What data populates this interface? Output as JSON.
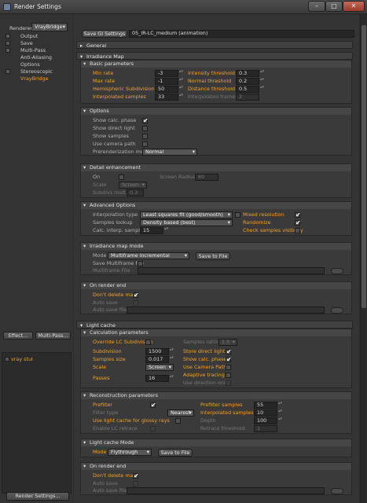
{
  "window": {
    "title": "Render Settings",
    "min": "–",
    "max": "□",
    "close": "✕"
  },
  "left": {
    "renderer_label": "Renderer",
    "renderer_value": "VrayBridge",
    "tree": [
      {
        "label": "Output"
      },
      {
        "label": "Save"
      },
      {
        "label": "Multi-Pass"
      },
      {
        "label": "Anti-Aliasing"
      },
      {
        "label": "Options"
      },
      {
        "label": "Stereoscopic"
      },
      {
        "label": "VrayBridge"
      }
    ],
    "effect_button": "Effect...",
    "multipass_button": "Multi-Pass...",
    "preset": "vray stul",
    "render_settings_button": "Render Settings..."
  },
  "top": {
    "save_gi_button": "Save GI Settings",
    "gi_path": "05_IR-LC_medium (animation)"
  },
  "sections": {
    "general": "General",
    "irradiance": "Irradiance Map",
    "lightcache": "Light cache"
  },
  "basic": {
    "title": "Basic parameters",
    "min_rate": "Min rate",
    "min_rate_val": "-3",
    "max_rate": "Max rate",
    "max_rate_val": "-1",
    "hemi": "Hemispheric Subdivision",
    "hemi_val": "50",
    "interp": "Interpolated samples",
    "interp_val": "33",
    "intensity": "Intensity threshold",
    "intensity_val": "0.3",
    "normal": "Normal threshold",
    "normal_val": "0.2",
    "distance": "Distance threshold",
    "distance_val": "0.5",
    "interp_frames": "Interpolated frames",
    "interp_frames_val": "2"
  },
  "options": {
    "title": "Options",
    "show_calc": "Show calc. phase",
    "show_direct": "Show direct light",
    "show_samples": "Show samples",
    "use_camera": "Use camera path",
    "prerender": "Prerenderization mode",
    "prerender_val": "Normal"
  },
  "detail": {
    "title": "Detail enhancement",
    "on": "On",
    "screen_radius": "Screen Radius",
    "screen_radius_val": "60",
    "scale": "Scale",
    "scale_val": "Screen",
    "subdivs": "Subdivs mult.",
    "subdivs_val": "0.3"
  },
  "advanced": {
    "title": "Advanced Options",
    "interp_type": "Interpolation type",
    "interp_type_val": "Least squares fit (good/smooth)",
    "samples_lookup": "Samples lookup",
    "samples_lookup_val": "Density based (best)",
    "calc_interp": "Calc. interp. samples",
    "calc_interp_val": "15",
    "mixed": "Mixed resolution",
    "randomize": "Randomize",
    "check_vis": "Check samples visibility"
  },
  "irmode": {
    "title": "Irradiance map mode",
    "mode": "Mode",
    "mode_val": "Multiframe incremental",
    "save_btn": "Save to File",
    "save_mf": "Save Multiframe File",
    "mf_file": "Multiframe File"
  },
  "ir_end": {
    "title": "On render end",
    "dont_delete": "Don't delete map",
    "auto_save": "Auto save",
    "auto_save_file": "Auto save file"
  },
  "calc": {
    "title": "Calculation parameters",
    "override": "Override LC Subdivision",
    "samples_ratio": "Samples ratio",
    "samples_ratio_val": "1.5",
    "subdivision": "Subdivision",
    "subdivision_val": "1500",
    "sample_size": "Samples size",
    "sample_size_val": "0.017",
    "scale": "Scale",
    "scale_val": "Screen",
    "passes": "Passes",
    "passes_val": "16",
    "store_direct": "Store direct light",
    "show_calc": "Show calc. phase",
    "use_camera": "Use Camera Path",
    "adaptive": "Adaptive tracing",
    "use_dir": "Use direction only"
  },
  "recon": {
    "title": "Reconstruction parameters",
    "prefilter": "Prefilter",
    "filter_type": "Filter type",
    "filter_type_val": "Nearest",
    "use_lc_glossy": "Use light cache for glossy rays",
    "enable_retrace": "Enable LC retrace",
    "prefilter_samples": "Prefilter samples",
    "prefilter_samples_val": "55",
    "interp_samples": "Interpolated samples",
    "interp_samples_val": "10",
    "depth": "Depth",
    "depth_val": "100",
    "retrace": "Retrace threshold",
    "retrace_val": "1"
  },
  "lcmode": {
    "title": "Light cache Mode",
    "mode": "Mode",
    "mode_val": "Flythrough",
    "save_btn": "Save to File"
  },
  "lc_end": {
    "title": "On render end",
    "dont_delete": "Don't delete map",
    "auto_save": "Auto save",
    "auto_save_file": "Auto save file"
  }
}
